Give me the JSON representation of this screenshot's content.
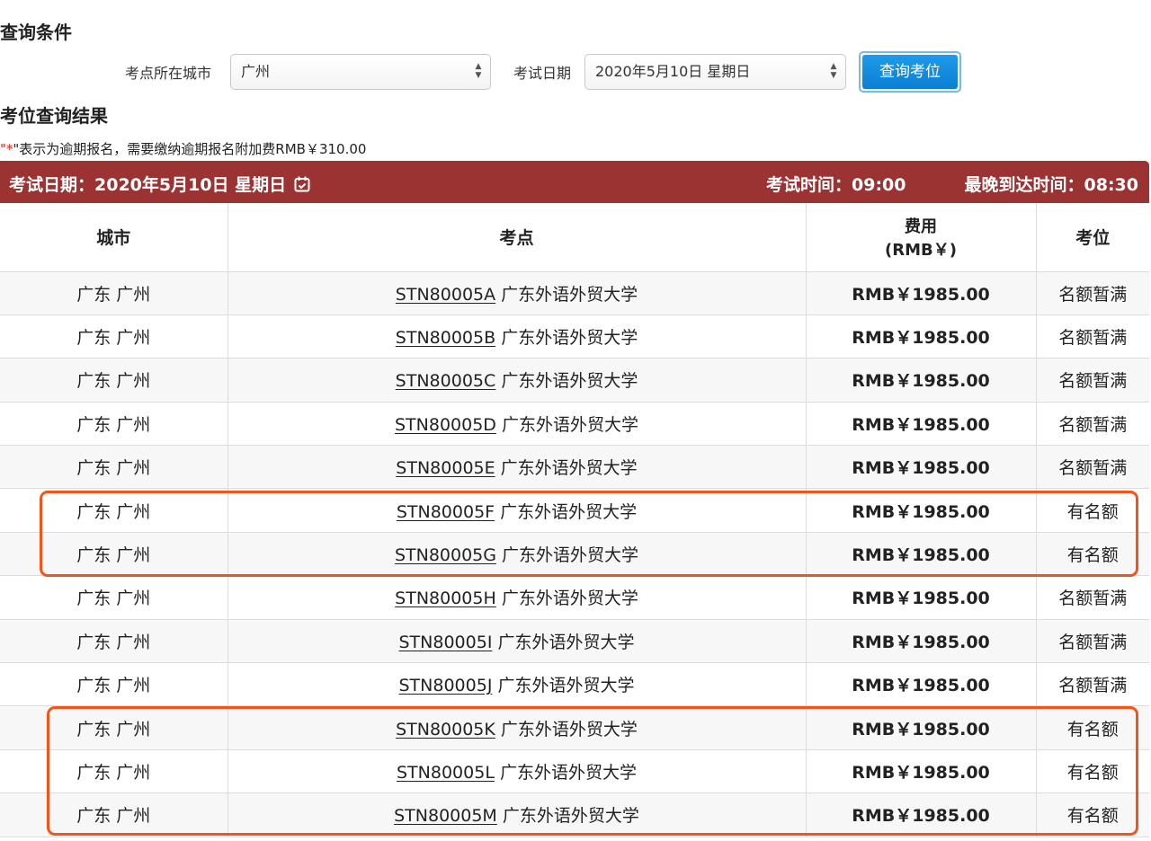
{
  "search": {
    "title": "查询条件",
    "city_label": "考点所在城市",
    "city_value": "广州",
    "date_label": "考试日期",
    "date_value": "2020年5月10日 星期日",
    "query_button": "查询考位"
  },
  "results": {
    "title": "考位查询结果",
    "note_star": "*",
    "note_open_quote": "\"",
    "note_text": "\"表示为逾期报名，需要缴纳逾期报名附加费RMB￥310.00",
    "banner": {
      "date": "考试日期：2020年5月10日 星期日",
      "exam_time": "考试时间：09:00",
      "latest_arrival": "最晚到达时间：08:30",
      "calendar_icon": "calendar-check-icon"
    },
    "columns": {
      "city": "城市",
      "site": "考点",
      "fee_line1": "费用",
      "fee_line2": "(RMB￥)",
      "seat": "考位"
    },
    "rows": [
      {
        "city": "广东 广州",
        "code": "STN80005A",
        "name": "广东外语外贸大学",
        "fee": "RMB￥1985.00",
        "seat": "名额暂满"
      },
      {
        "city": "广东 广州",
        "code": "STN80005B",
        "name": "广东外语外贸大学",
        "fee": "RMB￥1985.00",
        "seat": "名额暂满"
      },
      {
        "city": "广东 广州",
        "code": "STN80005C",
        "name": "广东外语外贸大学",
        "fee": "RMB￥1985.00",
        "seat": "名额暂满"
      },
      {
        "city": "广东 广州",
        "code": "STN80005D",
        "name": "广东外语外贸大学",
        "fee": "RMB￥1985.00",
        "seat": "名额暂满"
      },
      {
        "city": "广东 广州",
        "code": "STN80005E",
        "name": "广东外语外贸大学",
        "fee": "RMB￥1985.00",
        "seat": "名额暂满"
      },
      {
        "city": "广东 广州",
        "code": "STN80005F",
        "name": "广东外语外贸大学",
        "fee": "RMB￥1985.00",
        "seat": "有名额"
      },
      {
        "city": "广东 广州",
        "code": "STN80005G",
        "name": "广东外语外贸大学",
        "fee": "RMB￥1985.00",
        "seat": "有名额"
      },
      {
        "city": "广东 广州",
        "code": "STN80005H",
        "name": "广东外语外贸大学",
        "fee": "RMB￥1985.00",
        "seat": "名额暂满"
      },
      {
        "city": "广东 广州",
        "code": "STN80005I",
        "name": "广东外语外贸大学",
        "fee": "RMB￥1985.00",
        "seat": "名额暂满"
      },
      {
        "city": "广东 广州",
        "code": "STN80005J",
        "name": "广东外语外贸大学",
        "fee": "RMB￥1985.00",
        "seat": "名额暂满"
      },
      {
        "city": "广东 广州",
        "code": "STN80005K",
        "name": "广东外语外贸大学",
        "fee": "RMB￥1985.00",
        "seat": "有名额"
      },
      {
        "city": "广东 广州",
        "code": "STN80005L",
        "name": "广东外语外贸大学",
        "fee": "RMB￥1985.00",
        "seat": "有名额"
      },
      {
        "city": "广东 广州",
        "code": "STN80005M",
        "name": "广东外语外贸大学",
        "fee": "RMB￥1985.00",
        "seat": "有名额"
      }
    ]
  },
  "colors": {
    "banner_bg": "#9b3333",
    "button_bg": "#0b7fd3",
    "highlight": "#f2541b",
    "note_star": "#e0261b"
  }
}
